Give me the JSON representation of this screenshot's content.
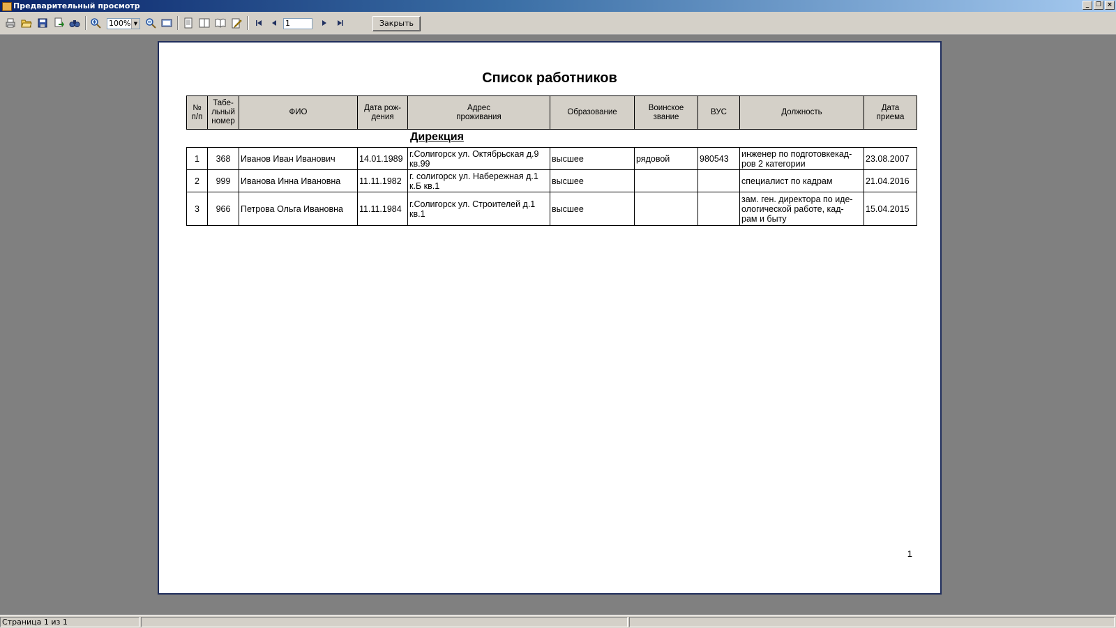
{
  "window": {
    "title": "Предварительный просмотр"
  },
  "toolbar": {
    "zoom_value": "100%",
    "page_value": "1",
    "close_label": "Закрыть"
  },
  "report": {
    "title": "Список работников",
    "headers": {
      "num": "№\nп/п",
      "tab": "Табе-\nльный\nномер",
      "fio": "ФИО",
      "dob": "Дата рож-\nдения",
      "addr": "Адрес\nпроживания",
      "edu": "Образование",
      "rank": "Воинское\nзвание",
      "vus": "ВУС",
      "pos": "Должность",
      "hire": "Дата\nприема"
    },
    "section": "Дирекция",
    "rows": [
      {
        "num": "1",
        "tab": "368",
        "fio": "Иванов Иван Иванович",
        "dob": "14.01.1989",
        "addr": "г.Солигорск ул. Октябрьская д.9\nкв.99",
        "edu": "высшее",
        "rank": "рядовой",
        "vus": "980543",
        "pos": "инженер по подготовкекад-\nров 2 категории",
        "hire": "23.08.2007"
      },
      {
        "num": "2",
        "tab": "999",
        "fio": "Иванова Инна Ивановна",
        "dob": "11.11.1982",
        "addr": "г. солигорск ул. Набережная д.1\nк.Б кв.1",
        "edu": "высшее",
        "rank": "",
        "vus": "",
        "pos": "специалист по кадрам",
        "hire": "21.04.2016"
      },
      {
        "num": "3",
        "tab": "966",
        "fio": "Петрова Ольга Ивановна",
        "dob": "11.11.1984",
        "addr": "г.Солигорск ул. Строителей д.1\nкв.1",
        "edu": "высшее",
        "rank": "",
        "vus": "",
        "pos": "зам. ген. директора по иде-\nологической работе, кад-\nрам и быту",
        "hire": "15.04.2015"
      }
    ],
    "page_number": "1"
  },
  "status": {
    "page_info": "Страница 1 из 1"
  },
  "icons": [
    "print-icon",
    "open-icon",
    "save-icon",
    "export-icon",
    "find-icon",
    "zoom-in-icon",
    "zoom-out-icon",
    "full-page-icon",
    "single-page-icon",
    "two-pages-icon",
    "book-icon",
    "edit-icon",
    "first-page-icon",
    "prev-page-icon",
    "next-page-icon",
    "last-page-icon"
  ]
}
